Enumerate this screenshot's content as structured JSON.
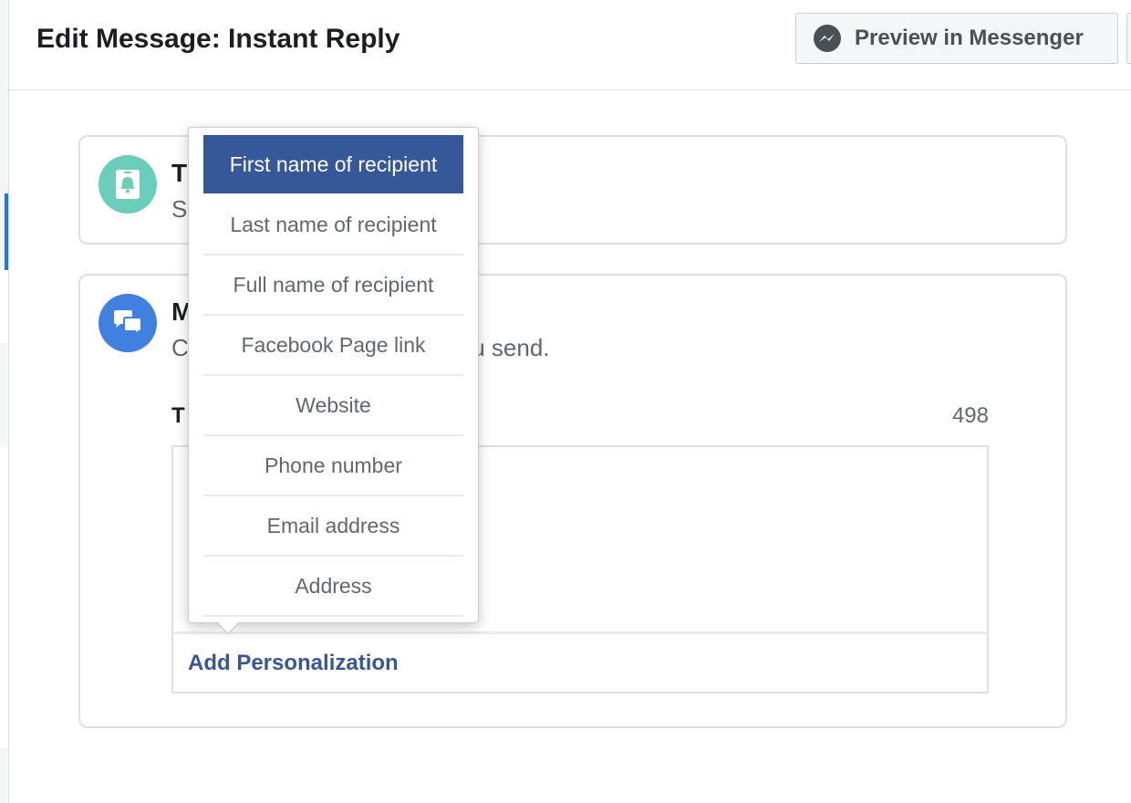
{
  "header": {
    "title": "Edit Message: Instant Reply",
    "preview_button": "Preview in Messenger"
  },
  "trigger_card": {
    "title_visible": "T",
    "subtitle_visible": "S",
    "icon": "bell-icon",
    "icon_color": "#6bcebb"
  },
  "message_card": {
    "title_visible": "M",
    "subtitle_left": "C",
    "subtitle_right": "ou send.",
    "icon": "chat-bubbles-icon",
    "icon_color": "#4080e0",
    "field_label_visible": "T",
    "char_count": "498",
    "add_personalization": "Add Personalization"
  },
  "personalization_menu": {
    "items": [
      {
        "label": "First name of recipient",
        "selected": true
      },
      {
        "label": "Last name of recipient",
        "selected": false
      },
      {
        "label": "Full name of recipient",
        "selected": false
      },
      {
        "label": "Facebook Page link",
        "selected": false
      },
      {
        "label": "Website",
        "selected": false
      },
      {
        "label": "Phone number",
        "selected": false
      },
      {
        "label": "Email address",
        "selected": false
      },
      {
        "label": "Address",
        "selected": false
      }
    ]
  },
  "colors": {
    "accent": "#365899",
    "messenger_blue": "#1877f2"
  }
}
